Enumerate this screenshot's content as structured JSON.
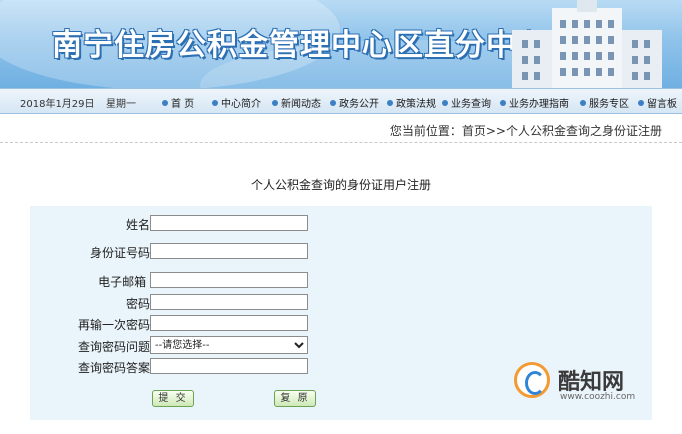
{
  "banner": {
    "title": "南宁住房公积金管理中心区直分中心"
  },
  "nav": {
    "date": "2018年1月29日",
    "weekday": "星期一",
    "items": [
      "首 页",
      "中心简介",
      "新闻动态",
      "政务公开",
      "政策法规",
      "业务查询",
      "业务办理指南",
      "服务专区",
      "留言板"
    ]
  },
  "breadcrumb": "您当前位置：首页>>个人公积金查询之身份证注册",
  "page_title": "个人公积金查询的身份证用户注册",
  "form": {
    "name_label": "姓名：",
    "id_label": "身份证号码：",
    "email_label": "电子邮箱 ：",
    "password_label": "密码：",
    "password_confirm_label": "再输一次密码：",
    "question_label": "查询密码问题：",
    "question_selected": "--请您选择--",
    "answer_label": "查询密码答案：",
    "submit_label": "提 交",
    "reset_label": "复 原"
  },
  "watermark": {
    "brand": "酷知网",
    "site": "www.coozhi.com"
  },
  "colors": {
    "nav_bullet": "#3b7fc4",
    "panel_bg": "#eaf4fb",
    "button_border": "#6aa354"
  }
}
